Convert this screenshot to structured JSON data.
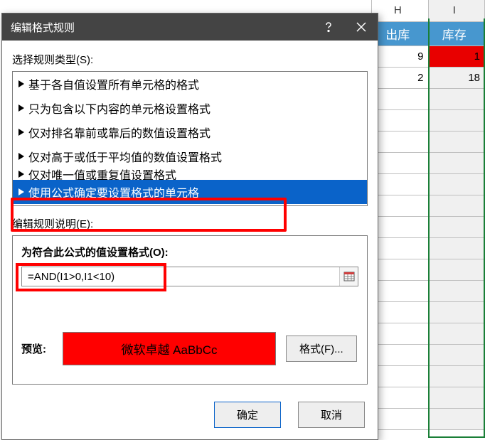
{
  "sheet": {
    "col_headers": [
      "H",
      "I"
    ],
    "data_headers": [
      "出库",
      "库存"
    ],
    "rows": [
      {
        "h": "9",
        "i": "1",
        "i_red": true
      },
      {
        "h": "2",
        "i": "18",
        "i_red": false
      }
    ]
  },
  "dialog": {
    "title": "编辑格式规则",
    "select_rule_type_label": "选择规则类型(S):",
    "rule_types": [
      "基于各自值设置所有单元格的格式",
      "只为包含以下内容的单元格设置格式",
      "仅对排名靠前或靠后的数值设置格式",
      "仅对高于或低于平均值的数值设置格式",
      "仅对唯一值或重复值设置格式",
      "使用公式确定要设置格式的单元格"
    ],
    "selected_rule_index": 5,
    "edit_rule_desc_label": "编辑规则说明(E):",
    "formula_box_title": "为符合此公式的值设置格式(O):",
    "formula_value": "=AND(I1>0,I1<10)",
    "preview_label": "预览:",
    "preview_text": "微软卓越 AaBbCc",
    "format_button_label": "格式(F)...",
    "ok_label": "确定",
    "cancel_label": "取消"
  }
}
